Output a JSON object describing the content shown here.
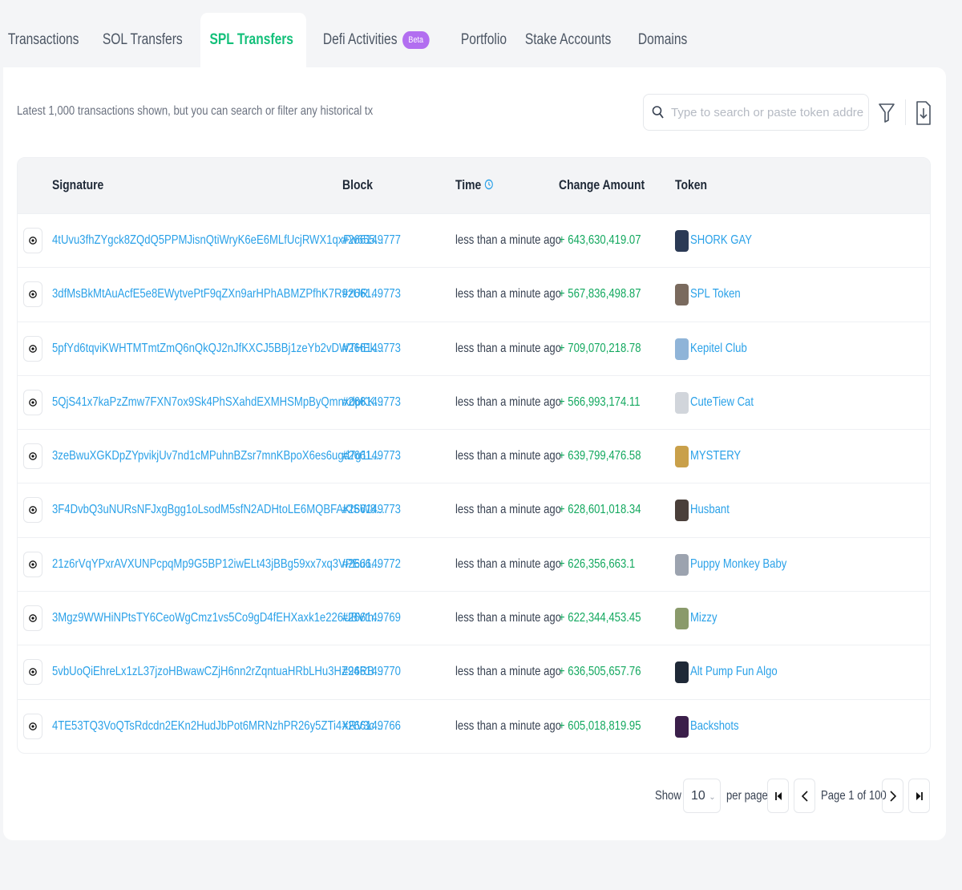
{
  "tabs": [
    {
      "label": "Transactions"
    },
    {
      "label": "SOL Transfers"
    },
    {
      "label": "SPL Transfers"
    },
    {
      "label": "Defi Activities",
      "badge": "Beta"
    },
    {
      "label": "Portfolio"
    },
    {
      "label": "Stake Accounts"
    },
    {
      "label": "Domains"
    }
  ],
  "active_tab": "SPL Transfers",
  "info_text": "Latest 1,000 transactions shown, but you can search or filter any historical tx",
  "search": {
    "placeholder": "Type to search or paste token address"
  },
  "columns": {
    "signature": "Signature",
    "block": "Block",
    "time": "Time",
    "amount": "Change Amount",
    "token": "Token"
  },
  "rows": [
    {
      "signature": "4tUvu3fhZYgck8ZQdQ5PPMJisnQtiWryK6eE6MLfUcjRWX1qxFw655...",
      "block": "#266149777",
      "time": "less than a minute ago",
      "amount": "+ 643,630,419.07",
      "token": "SHORK GAY",
      "logo_color": "#2b3a55"
    },
    {
      "signature": "3dfMsBkMtAuAcfE5e8EWytvePtF9qZXn9arHPhABMZPfhK7R9zUR...",
      "block": "#266149773",
      "time": "less than a minute ago",
      "amount": "+ 567,836,498.87",
      "token": "SPL Token",
      "logo_color": "#7a6a5e"
    },
    {
      "signature": "5pfYd6tqviKWHTMTmtZmQ6nQkQJ2nJfKXCJ5BBj1zeYb2vDWTHEk...",
      "block": "#266149773",
      "time": "less than a minute ago",
      "amount": "+ 709,070,218.78",
      "token": "Kepitel Club",
      "logo_color": "#8fb4d8"
    },
    {
      "signature": "5QjS41x7kaPzZmw7FXN7ox9Sk4PhSXahdEXMHSMpByQmnxdpKK...",
      "block": "#266149773",
      "time": "less than a minute ago",
      "amount": "+ 566,993,174.11",
      "token": "CuteTiew Cat",
      "logo_color": "#d1d5db"
    },
    {
      "signature": "3zeBwuXGKDpZYpvikjUv7nd1cMPuhnBZsr7mnKBpoX6es6ugd7g1L...",
      "block": "#266149773",
      "time": "less than a minute ago",
      "amount": "+ 639,799,476.58",
      "token": "MYSTERY",
      "logo_color": "#c9a04a"
    },
    {
      "signature": "3F4DvbQ3uNURsNFJxgBgg1oLsodM5sfN2ADHtoLE6MQBFAKtSW8...",
      "block": "#266149773",
      "time": "less than a minute ago",
      "amount": "+ 628,601,018.34",
      "token": "Husbant",
      "logo_color": "#4a3f3a"
    },
    {
      "signature": "21z6rVqYPxrAVXUNPcpqMp9G5BP12iwELt43jBBg59xx7xq3VPEu6...",
      "block": "#266149772",
      "time": "less than a minute ago",
      "amount": "+ 626,356,663.1",
      "token": "Puppy Monkey Baby",
      "logo_color": "#9ca3af"
    },
    {
      "signature": "3Mgz9WWHiNPtsTY6CeoWgCmz1vs5Co9gD4fEHXaxk1e226UBVth...",
      "block": "#266149769",
      "time": "less than a minute ago",
      "amount": "+ 622,344,453.45",
      "token": "Mizzy",
      "logo_color": "#8a9a6b"
    },
    {
      "signature": "5vbUoQiEhreLx1zL37jzoHBwawCZjH6nn2rZqntuaHRbLHu3HZ94RB...",
      "block": "#266149770",
      "time": "less than a minute ago",
      "amount": "+ 636,505,657.76",
      "token": "Alt Pump Fun Algo",
      "logo_color": "#1f2937"
    },
    {
      "signature": "4TE53TQ3VoQTsRdcdn2EKn2HudJbPot6MRNzhPR26y5ZTi4XRV3c...",
      "block": "#266149766",
      "time": "less than a minute ago",
      "amount": "+ 605,018,819.95",
      "token": "Backshots",
      "logo_color": "#3b1f4a"
    }
  ],
  "pagination": {
    "show": "Show",
    "per_page_value": "10",
    "per_page": "per page",
    "page_text": "Page 1 of 100"
  }
}
